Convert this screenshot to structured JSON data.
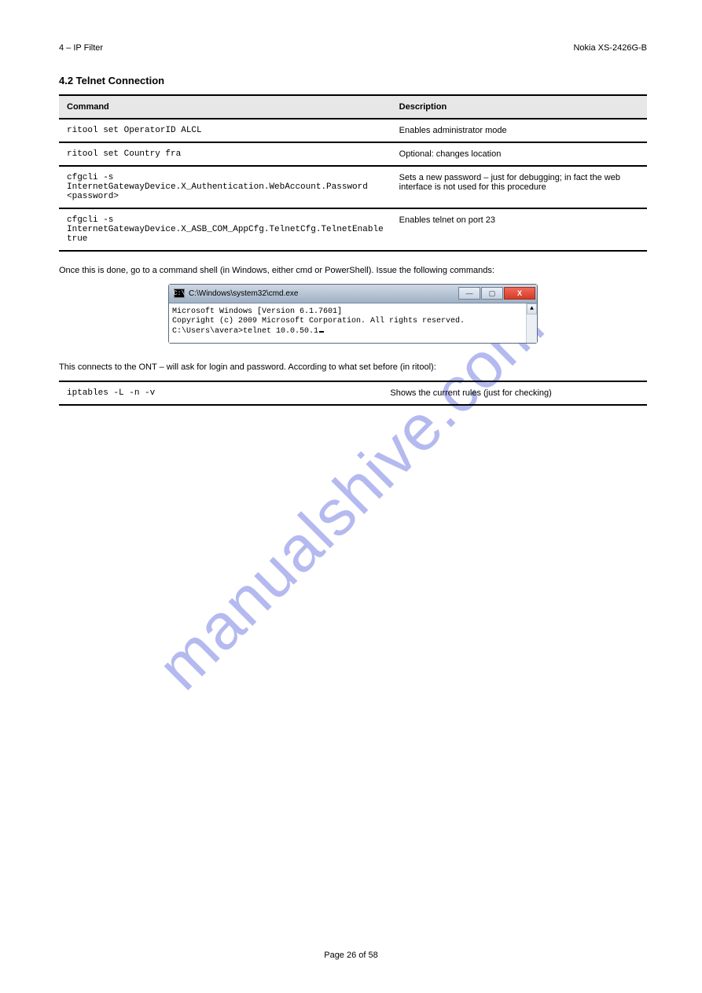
{
  "header": {
    "left": "4 – IP Filter",
    "right": "Nokia XS-2426G-B"
  },
  "section": {
    "title": "4.2 Telnet Connection",
    "intro_cmds_header": {
      "command": "Command",
      "description": "Description"
    },
    "intro_cmds": [
      {
        "cmd": "ritool set OperatorID ALCL",
        "desc": "Enables administrator mode"
      },
      {
        "cmd": "ritool set Country fra",
        "desc": "Optional: changes location"
      },
      {
        "cmd": "cfgcli -s InternetGatewayDevice.X_Authentication.WebAccount.Password <password>",
        "desc": "Sets a new password – just for debugging; in fact the web interface is not used for this procedure"
      },
      {
        "cmd": "cfgcli -s InternetGatewayDevice.X_ASB_COM_AppCfg.TelnetCfg.TelnetEnable true",
        "desc": "Enables telnet on port 23"
      }
    ],
    "para1": "Once this is done, go to a command shell (in Windows, either cmd or PowerShell). Issue the following commands:",
    "terminal": {
      "title": "C:\\Windows\\system32\\cmd.exe",
      "line1": "Microsoft Windows [Version 6.1.7601]",
      "line2": "Copyright (c) 2009 Microsoft Corporation.  All rights reserved.",
      "blank": "",
      "line3": "C:\\Users\\avera>telnet 10.0.50.1"
    },
    "para2": "This connects to the ONT – will ask for login and password. According to what set before (in ritool):",
    "rules": [
      {
        "cmd": "iptables -L -n -v",
        "desc": "Shows the current rules (just for checking)"
      }
    ]
  },
  "footer": {
    "text": "Page 26 of 58"
  },
  "watermark": "manualshive.com"
}
